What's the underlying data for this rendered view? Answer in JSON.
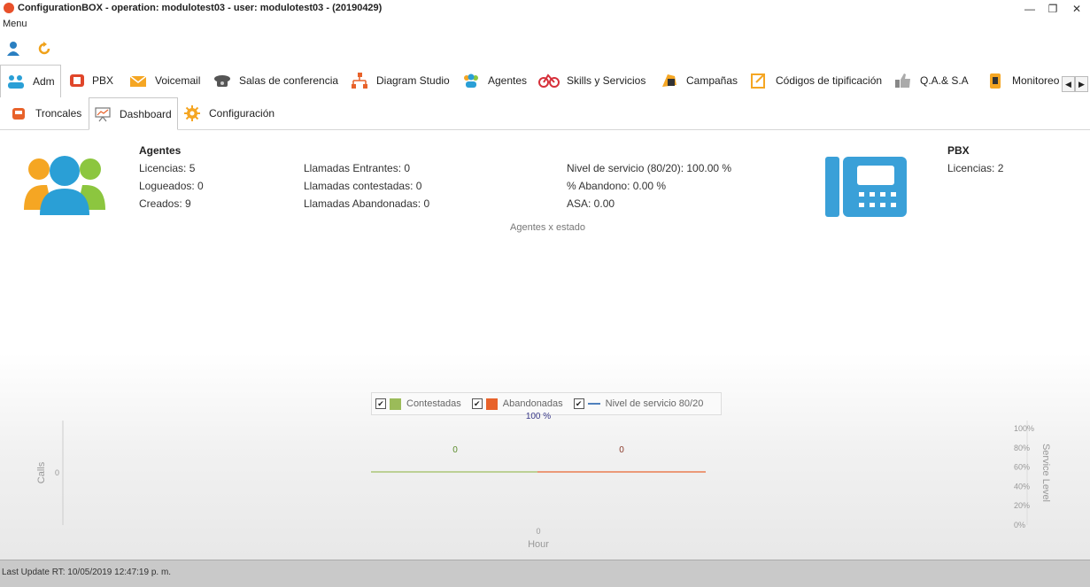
{
  "window": {
    "title": "ConfigurationBOX  -  operation: modulotest03  -  user: modulotest03  -  (20190429)",
    "minimize": "—",
    "restore": "❐",
    "close": "✕"
  },
  "menu": {
    "label": "Menu"
  },
  "main_tabs": [
    {
      "label": "Adm",
      "icon": "admin-icon"
    },
    {
      "label": "PBX",
      "icon": "pbx-icon"
    },
    {
      "label": "Voicemail",
      "icon": "voicemail-icon"
    },
    {
      "label": "Salas de conferencia",
      "icon": "conference-phone-icon"
    },
    {
      "label": "Diagram Studio",
      "icon": "diagram-icon"
    },
    {
      "label": "Agentes",
      "icon": "agents-icon"
    },
    {
      "label": "Skills y Servicios",
      "icon": "skills-icon"
    },
    {
      "label": "Campañas",
      "icon": "campaign-icon"
    },
    {
      "label": "Códigos de tipificación",
      "icon": "codes-icon"
    },
    {
      "label": "Q.A.&  S.A",
      "icon": "thumbs-up-icon"
    },
    {
      "label": "Monitoreo",
      "icon": "monitor-icon"
    }
  ],
  "sub_tabs": [
    {
      "label": "Troncales",
      "icon": "trunks-icon"
    },
    {
      "label": "Dashboard",
      "icon": "dashboard-icon"
    },
    {
      "label": "Configuración",
      "icon": "gear-icon"
    }
  ],
  "agents": {
    "heading": "Agentes",
    "licenses": "Licencias: 5",
    "logged": "Logueados: 0",
    "created": "Creados: 9"
  },
  "calls": {
    "incoming": "Llamadas Entrantes: 0",
    "answered": "Llamadas contestadas: 0",
    "abandoned": "Llamadas Abandonadas: 0"
  },
  "service": {
    "level": "Nivel de servicio (80/20): 100.00 %",
    "abandon": "% Abandono: 0.00 %",
    "asa": "ASA: 0.00"
  },
  "pbx": {
    "heading": "PBX",
    "licenses": "Licencias: 2"
  },
  "agents_by_state_title": "Agentes x estado",
  "legend": {
    "answered": "Contestadas",
    "abandoned": "Abandonadas",
    "service_level": "Nivel de servicio 80/20"
  },
  "colors": {
    "answered": "#9bbb59",
    "abandoned": "#e8622a",
    "service_level": "#4f81bd",
    "agents_orange": "#f5a623",
    "agents_blue": "#2a9fd6",
    "agents_green": "#8cc63f",
    "phone_blue": "#3aa0d8"
  },
  "chart_data": {
    "type": "bar",
    "categories": [
      "0"
    ],
    "series": [
      {
        "name": "Contestadas",
        "values": [
          0
        ]
      },
      {
        "name": "Abandonadas",
        "values": [
          0
        ]
      },
      {
        "name": "Nivel de servicio 80/20",
        "values": [
          100
        ]
      }
    ],
    "xlabel": "Hour",
    "ylabel": "Calls",
    "y2label": "Service Level",
    "y_ticks": [
      "0"
    ],
    "y2_ticks": [
      "100%",
      "80%",
      "60%",
      "40%",
      "20%",
      "0%"
    ],
    "data_labels": [
      "0",
      "0",
      "100 %"
    ]
  },
  "status": {
    "last_update": "Last Update RT: 10/05/2019 12:47:19 p. m."
  }
}
